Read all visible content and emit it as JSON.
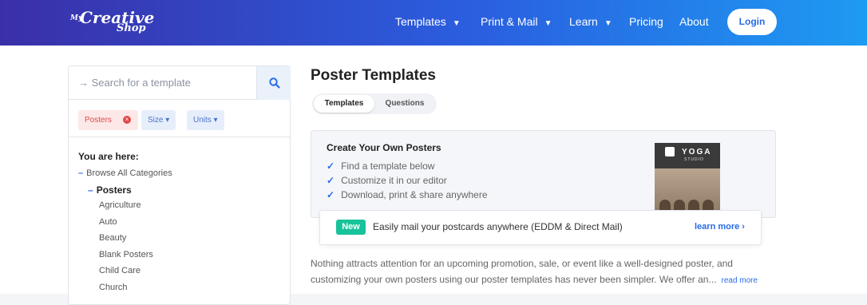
{
  "header": {
    "logo": {
      "my": "My",
      "creative": "Creative",
      "shop": "Shop"
    },
    "nav": [
      {
        "label": "Templates",
        "dropdown": true
      },
      {
        "label": "Print & Mail",
        "dropdown": true
      },
      {
        "label": "Learn",
        "dropdown": true
      },
      {
        "label": "Pricing",
        "dropdown": false
      },
      {
        "label": "About",
        "dropdown": false
      }
    ],
    "login_label": "Login",
    "caret": "▼"
  },
  "sidebar": {
    "search_placeholder": "→ Search for a template",
    "filters": {
      "posters": "Posters",
      "size": "Size ▾",
      "units": "Units ▾"
    },
    "breadcrumb_heading": "You are here:",
    "browse_all": "Browse All Categories",
    "current": "Posters",
    "categories": [
      "Agriculture",
      "Auto",
      "Beauty",
      "Blank Posters",
      "Child Care",
      "Church"
    ]
  },
  "main": {
    "title": "Poster Templates",
    "tabs": [
      "Templates",
      "Questions"
    ],
    "promo": {
      "heading": "Create Your Own Posters",
      "features": [
        "Find a template below",
        "Customize it in our editor",
        "Download, print & share anywhere"
      ],
      "poster_title": "YOGA",
      "poster_sub": "STUDIO"
    },
    "banner": {
      "badge": "New",
      "message": "Easily mail your postcards anywhere (EDDM & Direct Mail)",
      "link": "learn more ›"
    },
    "description": "Nothing attracts attention for an upcoming promotion, sale, or event like a well-designed poster, and customizing your own posters using our poster templates has never been simpler. We offer an...",
    "read_more": "read more"
  },
  "colors": {
    "brand_gradient_start": "#3a2fa8",
    "brand_gradient_end": "#1d9bf2",
    "accent": "#2a6be6",
    "new_badge": "#17c39a"
  }
}
